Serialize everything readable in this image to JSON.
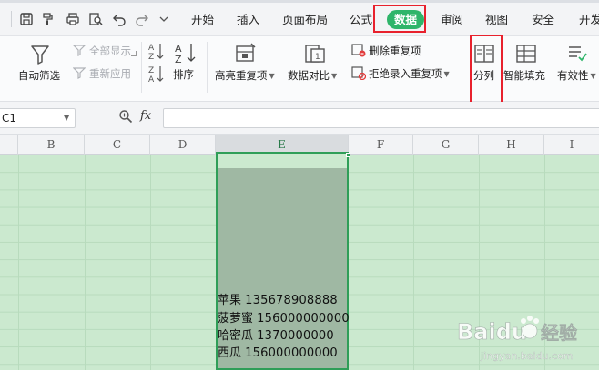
{
  "menu": {
    "items": [
      {
        "label": "开始",
        "name": "menu-home"
      },
      {
        "label": "插入",
        "name": "menu-insert"
      },
      {
        "label": "页面布局",
        "name": "menu-page-layout"
      },
      {
        "label": "公式",
        "name": "menu-formulas"
      },
      {
        "label": "审阅",
        "name": "menu-review"
      },
      {
        "label": "视图",
        "name": "menu-view"
      },
      {
        "label": "安全",
        "name": "menu-security"
      },
      {
        "label": "开发",
        "name": "menu-developer"
      }
    ],
    "active": "数据"
  },
  "quick_access": [
    "save-icon",
    "format-painter-icon",
    "print-icon",
    "print-preview-icon",
    "undo-icon",
    "redo-icon",
    "customize-dropdown-icon"
  ],
  "ribbon": {
    "auto_filter": "自动筛选",
    "show_all": "全部显示",
    "reapply": "重新应用",
    "sort": "排序",
    "highlight_duplicates": "高亮重复项",
    "data_compare": "数据对比",
    "remove_duplicates": "删除重复项",
    "reject_duplicates": "拒绝录入重复项",
    "split_columns": "分列",
    "smart_fill": "智能填充",
    "validation": "有效性"
  },
  "formula_bar": {
    "name_box": "C1",
    "fx": "fx",
    "formula": ""
  },
  "columns": [
    "B",
    "C",
    "D",
    "E",
    "F",
    "G",
    "H",
    "I"
  ],
  "selected_column": "E",
  "cell_lines": [
    {
      "fruit": "苹果",
      "number": "135678908888"
    },
    {
      "fruit": "菠萝蜜",
      "number": "156000000000"
    },
    {
      "fruit": "哈密瓜",
      "number": "1370000000"
    },
    {
      "fruit": "西瓜",
      "number": "156000000000"
    }
  ],
  "watermark": {
    "brand": "Baidu",
    "sub_brand": "经验",
    "url": "jingyan.baidu.com"
  },
  "colors": {
    "active_tab": "#2fb56a",
    "highlight": "#e8212d",
    "grid": "#cbe9cf",
    "selection": "#9fb8a3"
  }
}
